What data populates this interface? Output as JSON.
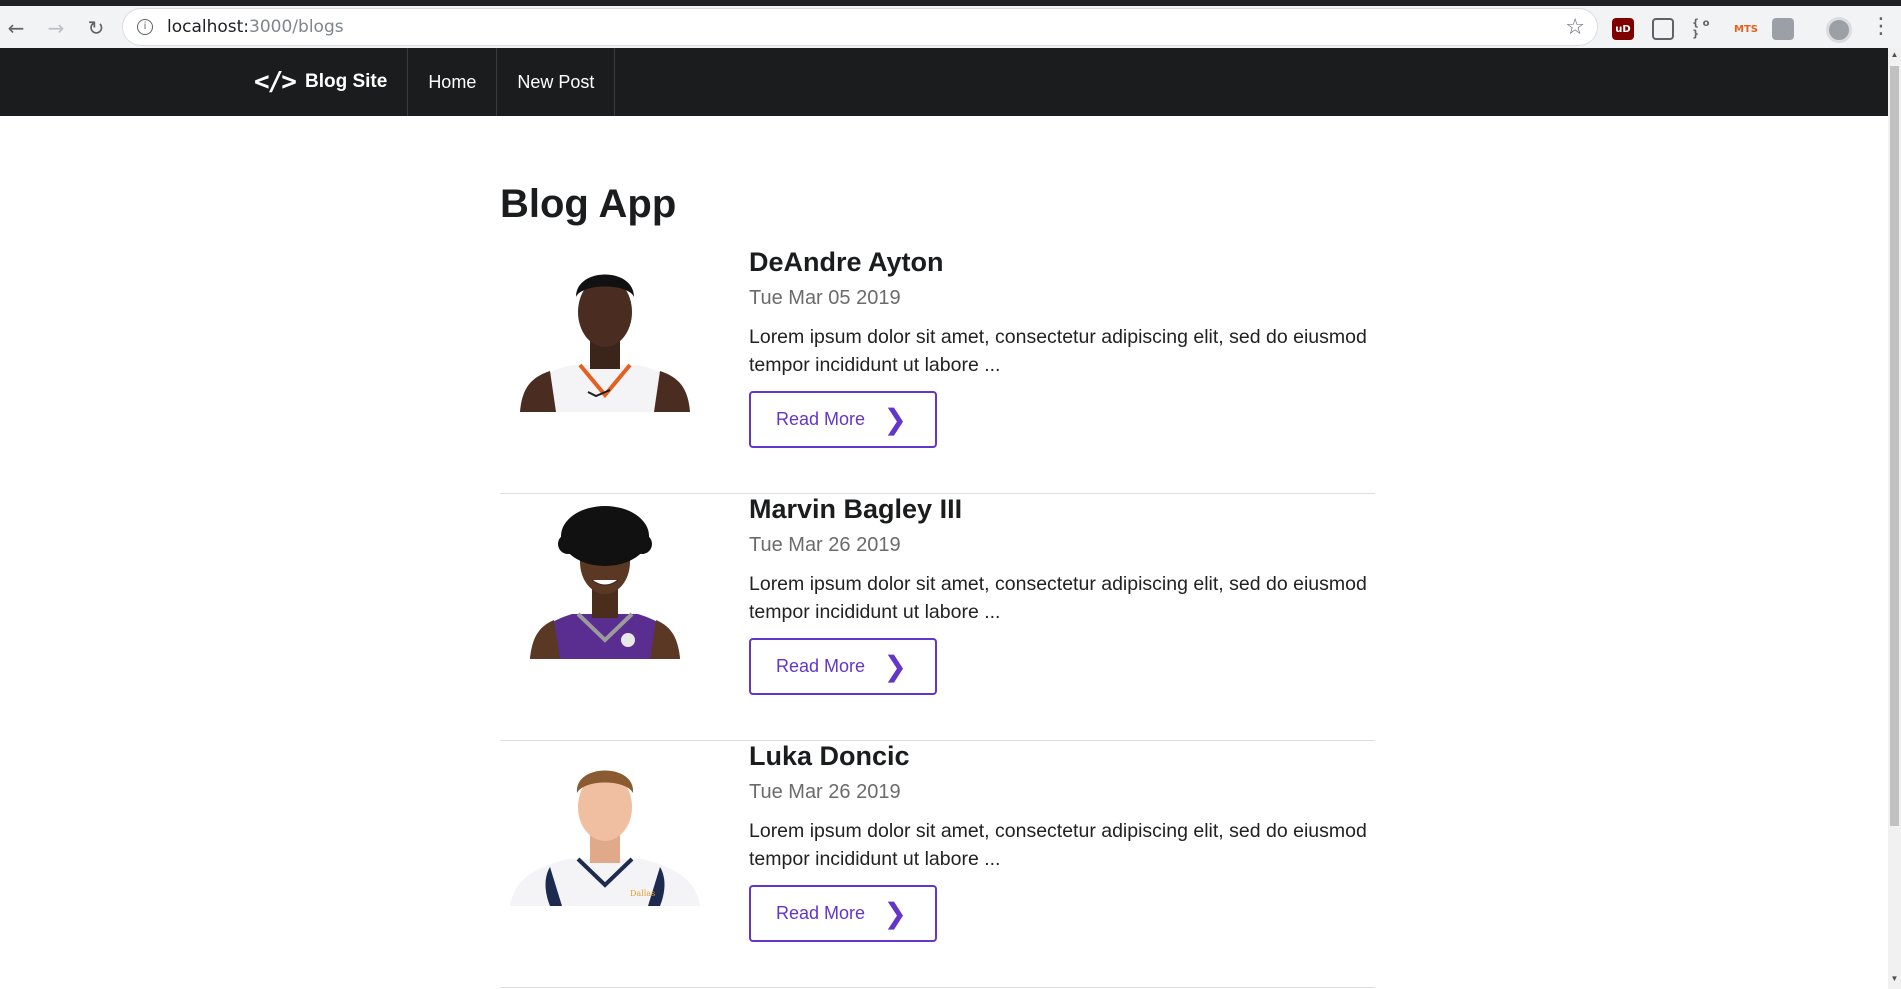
{
  "browser": {
    "url_host": "localhost:",
    "url_path": "3000/blogs",
    "back_icon": "arrow-left-icon",
    "forward_icon": "arrow-right-icon",
    "reload_icon": "reload-icon",
    "ext_labels": [
      "uD",
      "",
      "{ o }",
      "MTS",
      ""
    ]
  },
  "nav": {
    "brand_icon_text": "</>",
    "brand": "Blog Site",
    "links": [
      "Home",
      "New Post"
    ]
  },
  "main": {
    "title": "Blog App",
    "posts": [
      {
        "title": "DeAndre Ayton",
        "date": "Tue Mar 05 2019",
        "body": "Lorem ipsum dolor sit amet, consectetur adipiscing elit, sed do eiusmod tempor incididunt ut labore ...",
        "button": "Read More",
        "jersey_color": "#f4f4f6",
        "trim_color": "#e56020"
      },
      {
        "title": "Marvin Bagley III",
        "date": "Tue Mar 26 2019",
        "body": "Lorem ipsum dolor sit amet, consectetur adipiscing elit, sed do eiusmod tempor incididunt ut labore ...",
        "button": "Read More",
        "jersey_color": "#5a2d91",
        "trim_color": "#9b9b9b"
      },
      {
        "title": "Luka Doncic",
        "date": "Tue Mar 26 2019",
        "body": "Lorem ipsum dolor sit amet, consectetur adipiscing elit, sed do eiusmod tempor incididunt ut labore ...",
        "button": "Read More",
        "jersey_color": "#f4f4f6",
        "trim_color": "#1d2b4f"
      }
    ]
  },
  "colors": {
    "accent": "#6435c9",
    "nav_bg": "#1b1c1d"
  }
}
